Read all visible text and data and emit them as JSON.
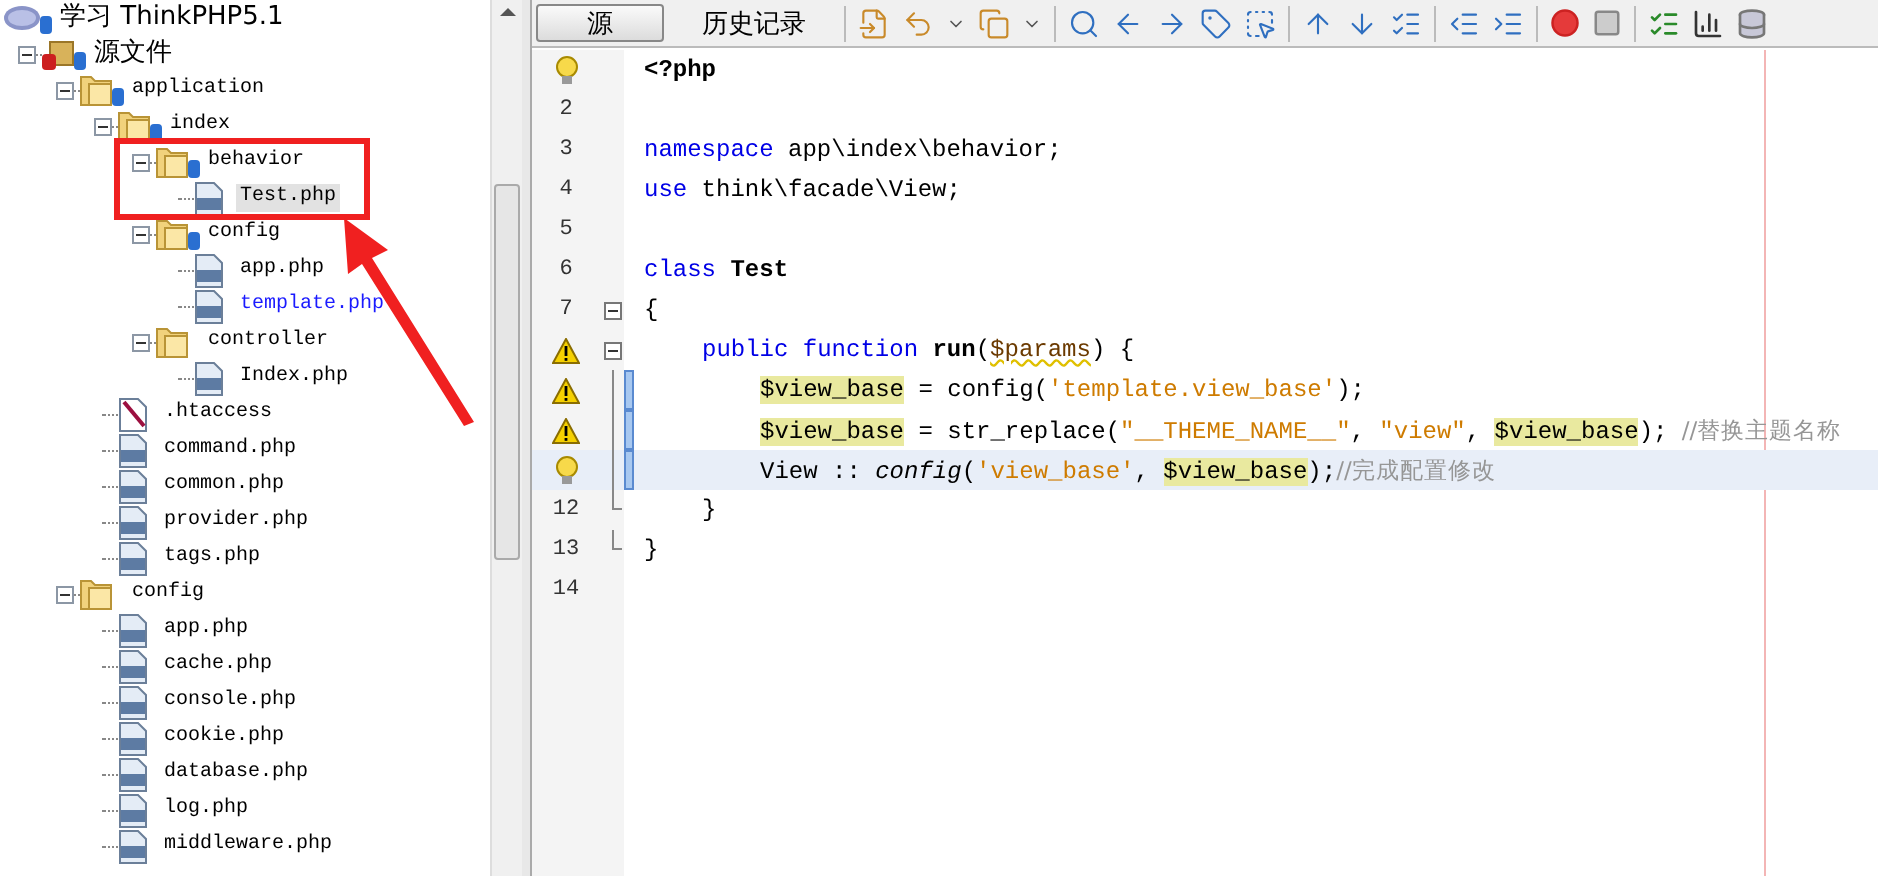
{
  "tree": [
    {
      "kind": "project",
      "label": "学习 ThinkPHP5.1",
      "versioned": true,
      "selected": false,
      "children": [
        {
          "kind": "source",
          "label": "源文件",
          "versioned": true,
          "selected": false,
          "expanded": true,
          "children": [
            {
              "kind": "folder",
              "label": "application",
              "versioned": true,
              "selected": false,
              "expanded": true,
              "children": [
                {
                  "kind": "folder",
                  "label": "index",
                  "versioned": true,
                  "selected": false,
                  "expanded": true,
                  "children": [
                    {
                      "kind": "folder",
                      "label": "behavior",
                      "versioned": true,
                      "selected": false,
                      "expanded": true,
                      "children": [
                        {
                          "kind": "php",
                          "label": "Test.php",
                          "selected": true
                        }
                      ]
                    },
                    {
                      "kind": "folder",
                      "label": "config",
                      "versioned": true,
                      "selected": false,
                      "expanded": true,
                      "children": [
                        {
                          "kind": "php",
                          "label": "app.php",
                          "selected": false
                        },
                        {
                          "kind": "php",
                          "label": "template.php",
                          "selected": false,
                          "modified": true
                        }
                      ]
                    },
                    {
                      "kind": "folder",
                      "label": "controller",
                      "versioned": false,
                      "selected": false,
                      "expanded": true,
                      "children": [
                        {
                          "kind": "php",
                          "label": "Index.php",
                          "selected": false
                        }
                      ]
                    }
                  ]
                },
                {
                  "kind": "htaccess",
                  "label": ".htaccess",
                  "selected": false
                },
                {
                  "kind": "php",
                  "label": "command.php",
                  "selected": false
                },
                {
                  "kind": "php",
                  "label": "common.php",
                  "selected": false
                },
                {
                  "kind": "php",
                  "label": "provider.php",
                  "selected": false
                },
                {
                  "kind": "php",
                  "label": "tags.php",
                  "selected": false
                }
              ]
            },
            {
              "kind": "folder",
              "label": "config",
              "versioned": false,
              "selected": false,
              "expanded": true,
              "children": [
                {
                  "kind": "php",
                  "label": "app.php",
                  "selected": false
                },
                {
                  "kind": "php",
                  "label": "cache.php",
                  "selected": false
                },
                {
                  "kind": "php",
                  "label": "console.php",
                  "selected": false
                },
                {
                  "kind": "php",
                  "label": "cookie.php",
                  "selected": false
                },
                {
                  "kind": "php",
                  "label": "database.php",
                  "selected": false
                },
                {
                  "kind": "php",
                  "label": "log.php",
                  "selected": false
                },
                {
                  "kind": "php",
                  "label": "middleware.php",
                  "selected": false
                }
              ]
            }
          ]
        }
      ]
    }
  ],
  "editor_tabs": [
    {
      "label": "源",
      "selected": true
    },
    {
      "label": "历史记录",
      "selected": false
    }
  ],
  "code_lines": [
    {
      "annotation": {
        "kind": "hint"
      },
      "changed": false,
      "current": false,
      "tokens": [
        {
          "kind": "bold",
          "text": "<?php"
        }
      ]
    },
    {
      "number": "2",
      "changed": false,
      "current": false
    },
    {
      "number": "3",
      "changed": false,
      "current": false,
      "tokens": [
        {
          "kind": "keyword",
          "text": "namespace"
        },
        {
          "kind": "plain",
          "text": " app\\index\\behavior;"
        }
      ]
    },
    {
      "number": "4",
      "changed": false,
      "current": false,
      "tokens": [
        {
          "kind": "keyword",
          "text": "use"
        },
        {
          "kind": "plain",
          "text": " think\\facade\\View;"
        }
      ]
    },
    {
      "number": "5",
      "changed": false,
      "current": false
    },
    {
      "number": "6",
      "changed": false,
      "current": false,
      "tokens": [
        {
          "kind": "keyword",
          "text": "class"
        },
        {
          "kind": "bold",
          "text": " Test"
        }
      ]
    },
    {
      "number": "7",
      "fold": {
        "kind": "open"
      },
      "changed": false,
      "current": false,
      "tokens": [
        {
          "kind": "plain",
          "text": "{"
        }
      ]
    },
    {
      "annotation": {
        "kind": "warning"
      },
      "fold": {
        "kind": "open"
      },
      "indent": {
        "kind": "single"
      },
      "changed": false,
      "current": false,
      "tokens": [
        {
          "kind": "keyword",
          "text": "public function"
        },
        {
          "kind": "bold",
          "text": " run"
        },
        {
          "kind": "plain",
          "text": "("
        },
        {
          "kind": "variable",
          "text": "$params"
        },
        {
          "kind": "plain",
          "text": ") {"
        }
      ]
    },
    {
      "annotation": {
        "kind": "warning"
      },
      "fold": {
        "kind": "line"
      },
      "indent": {
        "kind": "double"
      },
      "changed": true,
      "current": false,
      "tokens": [
        {
          "kind": "marked",
          "text": "$view_base"
        },
        {
          "kind": "plain",
          "text": " = config("
        },
        {
          "kind": "string",
          "text": "'template.view_base'"
        },
        {
          "kind": "plain",
          "text": ");"
        }
      ]
    },
    {
      "annotation": {
        "kind": "warning"
      },
      "fold": {
        "kind": "line"
      },
      "indent": {
        "kind": "double"
      },
      "changed": true,
      "current": false,
      "tokens": [
        {
          "kind": "marked",
          "text": "$view_base"
        },
        {
          "kind": "plain",
          "text": " = str_replace("
        },
        {
          "kind": "string",
          "text": "\"__THEME_NAME__\""
        },
        {
          "kind": "plain",
          "text": ", "
        },
        {
          "kind": "string",
          "text": "\"view\""
        },
        {
          "kind": "plain",
          "text": ", "
        },
        {
          "kind": "marked",
          "text": "$view_base"
        },
        {
          "kind": "plain",
          "text": "); "
        },
        {
          "kind": "comment",
          "text": "//替换主题名称"
        }
      ]
    },
    {
      "annotation": {
        "kind": "hint"
      },
      "fold": {
        "kind": "line"
      },
      "indent": {
        "kind": "double"
      },
      "changed": true,
      "current": true,
      "tokens": [
        {
          "kind": "plain",
          "text": "View :: "
        },
        {
          "kind": "italic",
          "text": "config"
        },
        {
          "kind": "plain",
          "text": "("
        },
        {
          "kind": "string",
          "text": "'view_base'"
        },
        {
          "kind": "plain",
          "text": ", "
        },
        {
          "kind": "marked",
          "text": "$view_base"
        },
        {
          "kind": "plain",
          "text": ");"
        },
        {
          "kind": "comment",
          "text": "//完成配置修改"
        }
      ]
    },
    {
      "number": "12",
      "fold": {
        "kind": "end"
      },
      "indent": {
        "kind": "single"
      },
      "changed": false,
      "current": false,
      "tokens": [
        {
          "kind": "plain",
          "text": "}"
        }
      ]
    },
    {
      "number": "13",
      "fold": {
        "kind": "end"
      },
      "changed": false,
      "current": false,
      "tokens": [
        {
          "kind": "plain",
          "text": "}"
        }
      ]
    },
    {
      "number": "14",
      "changed": false,
      "current": false
    }
  ]
}
